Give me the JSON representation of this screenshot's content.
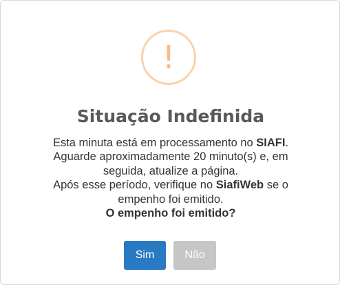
{
  "dialog": {
    "icon": "warning-exclamation-icon",
    "icon_glyph": "!",
    "icon_color": "#f8bb86",
    "title": "Situação Indefinida",
    "message": {
      "line1_text": "Esta minuta está em processamento no ",
      "line1_bold": "SIAFI",
      "line1_end": ".",
      "line2": "Aguarde aproximadamente 20 minuto(s) e, em seguida, atualize a página.",
      "line3_text": "Após esse período, verifique no ",
      "line3_bold": "SiafiWeb",
      "line3_end": " se o empenho foi emitido.",
      "question": "O empenho foi emitido?"
    },
    "buttons": {
      "confirm_label": "Sim",
      "confirm_color": "#2a7ac3",
      "cancel_label": "Não",
      "cancel_color": "#c6c6c6"
    }
  }
}
